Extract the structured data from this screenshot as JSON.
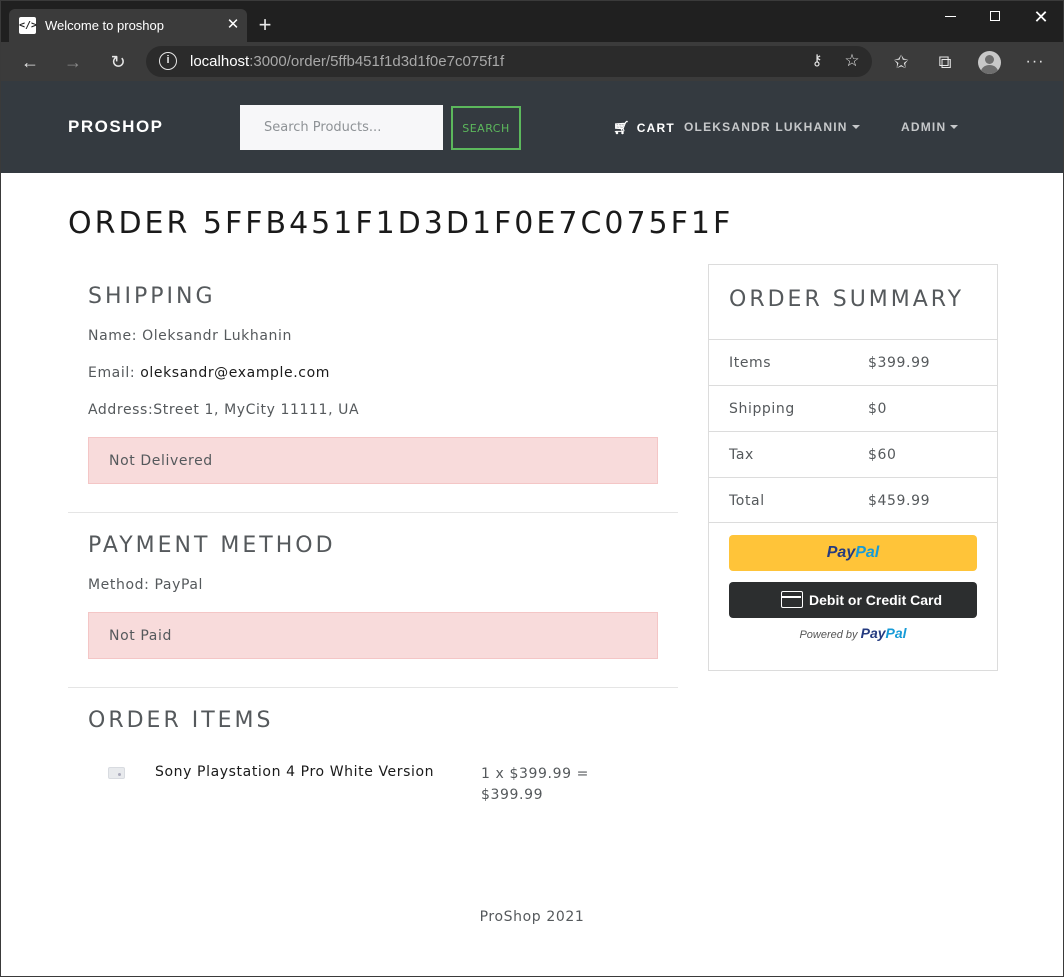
{
  "browser": {
    "tab_title": "Welcome to proshop",
    "url_host": "localhost",
    "url_rest": ":3000/order/5ffb451f1d3d1f0e7c075f1f"
  },
  "navbar": {
    "brand": "PROSHOP",
    "search_placeholder": "Search Products...",
    "search_button": "SEARCH",
    "cart": "CART",
    "user": "OLEKSANDR LUKHANIN",
    "admin": "ADMIN"
  },
  "order": {
    "title": "ORDER 5FFB451F1D3D1F0E7C075F1F",
    "shipping": {
      "heading": "SHIPPING",
      "name_label": "Name: ",
      "name": "Oleksandr Lukhanin",
      "email_label": "Email: ",
      "email": "oleksandr@example.com",
      "address_label": "Address:",
      "address": "Street 1, MyCity 11111, UA",
      "status": "Not Delivered"
    },
    "payment": {
      "heading": "PAYMENT METHOD",
      "method_label": "Method: ",
      "method": "PayPal",
      "status": "Not Paid"
    },
    "items": {
      "heading": "ORDER ITEMS",
      "list": [
        {
          "name": "Sony Playstation 4 Pro White Version",
          "price_calc": "1 x $399.99 = $399.99"
        }
      ]
    }
  },
  "summary": {
    "heading": "ORDER SUMMARY",
    "rows": [
      {
        "label": "Items",
        "value": "$399.99"
      },
      {
        "label": "Shipping",
        "value": "$0"
      },
      {
        "label": "Tax",
        "value": "$60"
      },
      {
        "label": "Total",
        "value": "$459.99"
      }
    ],
    "paypal_pay": "Pay",
    "paypal_pal": "Pal",
    "card_button": "Debit or Credit Card",
    "powered_by": "Powered by ",
    "powered_pay": "Pay",
    "powered_pal": "Pal"
  },
  "footer": "ProShop 2021",
  "colors": {
    "navbar_bg": "#343a40",
    "success": "#5cb85c",
    "alert_bg": "#f8dbdb",
    "paypal_yellow": "#ffc439"
  }
}
